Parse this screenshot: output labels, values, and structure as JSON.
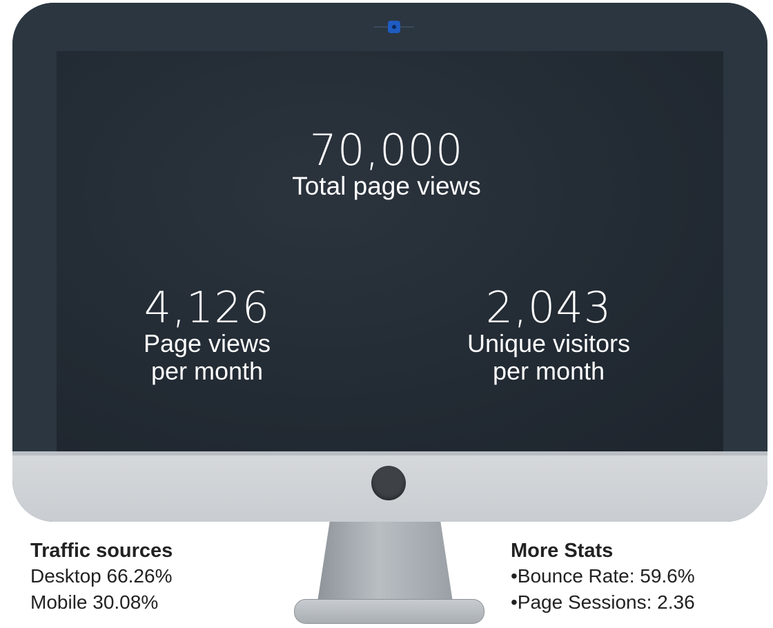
{
  "headline": {
    "total_value": "70,000",
    "total_label": "Total page views"
  },
  "monthly": {
    "page_views_value": "4,126",
    "page_views_label_1": "Page views",
    "page_views_label_2": "per month",
    "visitors_value": "2,043",
    "visitors_label_1": "Unique visitors",
    "visitors_label_2": "per month"
  },
  "traffic": {
    "title": "Traffic sources",
    "items": [
      "Desktop 66.26%",
      "Mobile 30.08%"
    ]
  },
  "more": {
    "title": "More Stats",
    "items": [
      "•Bounce Rate: 59.6%",
      "•Page Sessions: 2.36"
    ]
  },
  "colors": {
    "screen": "#222a33",
    "bezel": "#2b3640",
    "chin": "#d6d9dc",
    "camera": "#1f5cc2"
  },
  "icons": {
    "camera": "camera-icon",
    "home_button": "monitor-button-icon"
  }
}
